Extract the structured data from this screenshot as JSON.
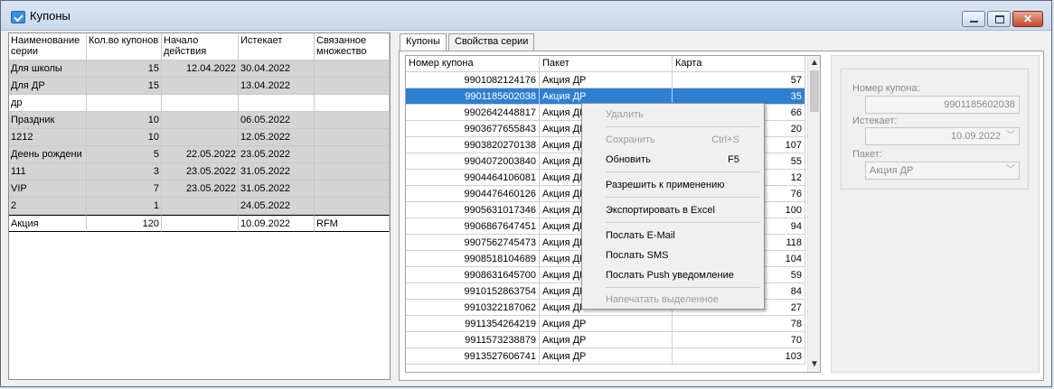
{
  "window": {
    "title": "Купоны"
  },
  "left_grid": {
    "headers": [
      "Наименование серии",
      "Кол.во купонов",
      "Начало действия",
      "Истекает",
      "Связанное множество"
    ],
    "rows": [
      [
        "Для школы",
        "15",
        "12.04.2022",
        "30.04.2022",
        ""
      ],
      [
        "Для ДР",
        "15",
        "",
        "13.04.2022",
        ""
      ],
      [
        "др",
        "",
        "",
        "",
        ""
      ],
      [
        "Праздник",
        "10",
        "",
        "06.05.2022",
        ""
      ],
      [
        "1212",
        "10",
        "",
        "12.05.2022",
        ""
      ],
      [
        "Деень рождени",
        "5",
        "22.05.2022",
        "23.05.2022",
        ""
      ],
      [
        "111",
        "3",
        "23.05.2022",
        "31.05.2022",
        ""
      ],
      [
        "VIP",
        "7",
        "23.05.2022",
        "31.05.2022",
        ""
      ],
      [
        "2",
        "1",
        "",
        "24.05.2022",
        ""
      ],
      [
        "Акция",
        "120",
        "",
        "10.09.2022",
        "RFM"
      ]
    ]
  },
  "tabs": [
    "Купоны",
    "Свойства серии"
  ],
  "coupon_grid": {
    "headers": [
      "Номер купона",
      "Пакет",
      "Карта"
    ],
    "rows": [
      [
        "9901082124176",
        "Акция ДР",
        "57"
      ],
      [
        "9901185602038",
        "Акция ДР",
        "35"
      ],
      [
        "9902642448817",
        "Акция ДР",
        "66"
      ],
      [
        "9903677655843",
        "Акция ДР",
        "20"
      ],
      [
        "9903820270138",
        "Акция ДР",
        "107"
      ],
      [
        "9904072003840",
        "Акция ДР",
        "55"
      ],
      [
        "9904464106081",
        "Акция ДР",
        "12"
      ],
      [
        "9904476460126",
        "Акция ДР",
        "76"
      ],
      [
        "9905631017346",
        "Акция ДР",
        "100"
      ],
      [
        "9906867647451",
        "Акция ДР",
        "94"
      ],
      [
        "9907562745473",
        "Акция ДР",
        "118"
      ],
      [
        "9908518104689",
        "Акция ДР",
        "104"
      ],
      [
        "9908631645700",
        "Акция ДР",
        "59"
      ],
      [
        "9910152863754",
        "Акция ДР",
        "84"
      ],
      [
        "9910322187062",
        "Акция ДР",
        "27"
      ],
      [
        "9911354264219",
        "Акция ДР",
        "78"
      ],
      [
        "9911573238879",
        "Акция ДР",
        "70"
      ],
      [
        "9913527606741",
        "Акция ДР",
        "103"
      ]
    ]
  },
  "context_menu": {
    "items": [
      {
        "label": "Удалить",
        "shortcut": "",
        "disabled": true
      },
      {
        "label": "Сохранить",
        "shortcut": "Ctrl+S",
        "disabled": true
      },
      {
        "label": "Обновить",
        "shortcut": "F5",
        "disabled": false
      },
      {
        "label": "Разрешить к применению",
        "shortcut": "",
        "disabled": false
      },
      {
        "label": "Экспортировать в Excel",
        "shortcut": "",
        "disabled": false
      },
      {
        "label": "Послать E-Mail",
        "shortcut": "",
        "disabled": false
      },
      {
        "label": "Послать SMS",
        "shortcut": "",
        "disabled": false
      },
      {
        "label": "Послать Push уведомление",
        "shortcut": "",
        "disabled": false
      },
      {
        "label": "Напечатать выделенное",
        "shortcut": "",
        "disabled": true
      }
    ]
  },
  "details": {
    "coupon_label": "Номер купона:",
    "coupon_value": "9901185602038",
    "expires_label": "Истекает:",
    "expires_value": "10.09.2022",
    "package_label": "Пакет:",
    "package_value": "Акция ДР"
  },
  "colors": {
    "selection": "#2f7fd1",
    "gray_row": "#d4d4d4"
  }
}
